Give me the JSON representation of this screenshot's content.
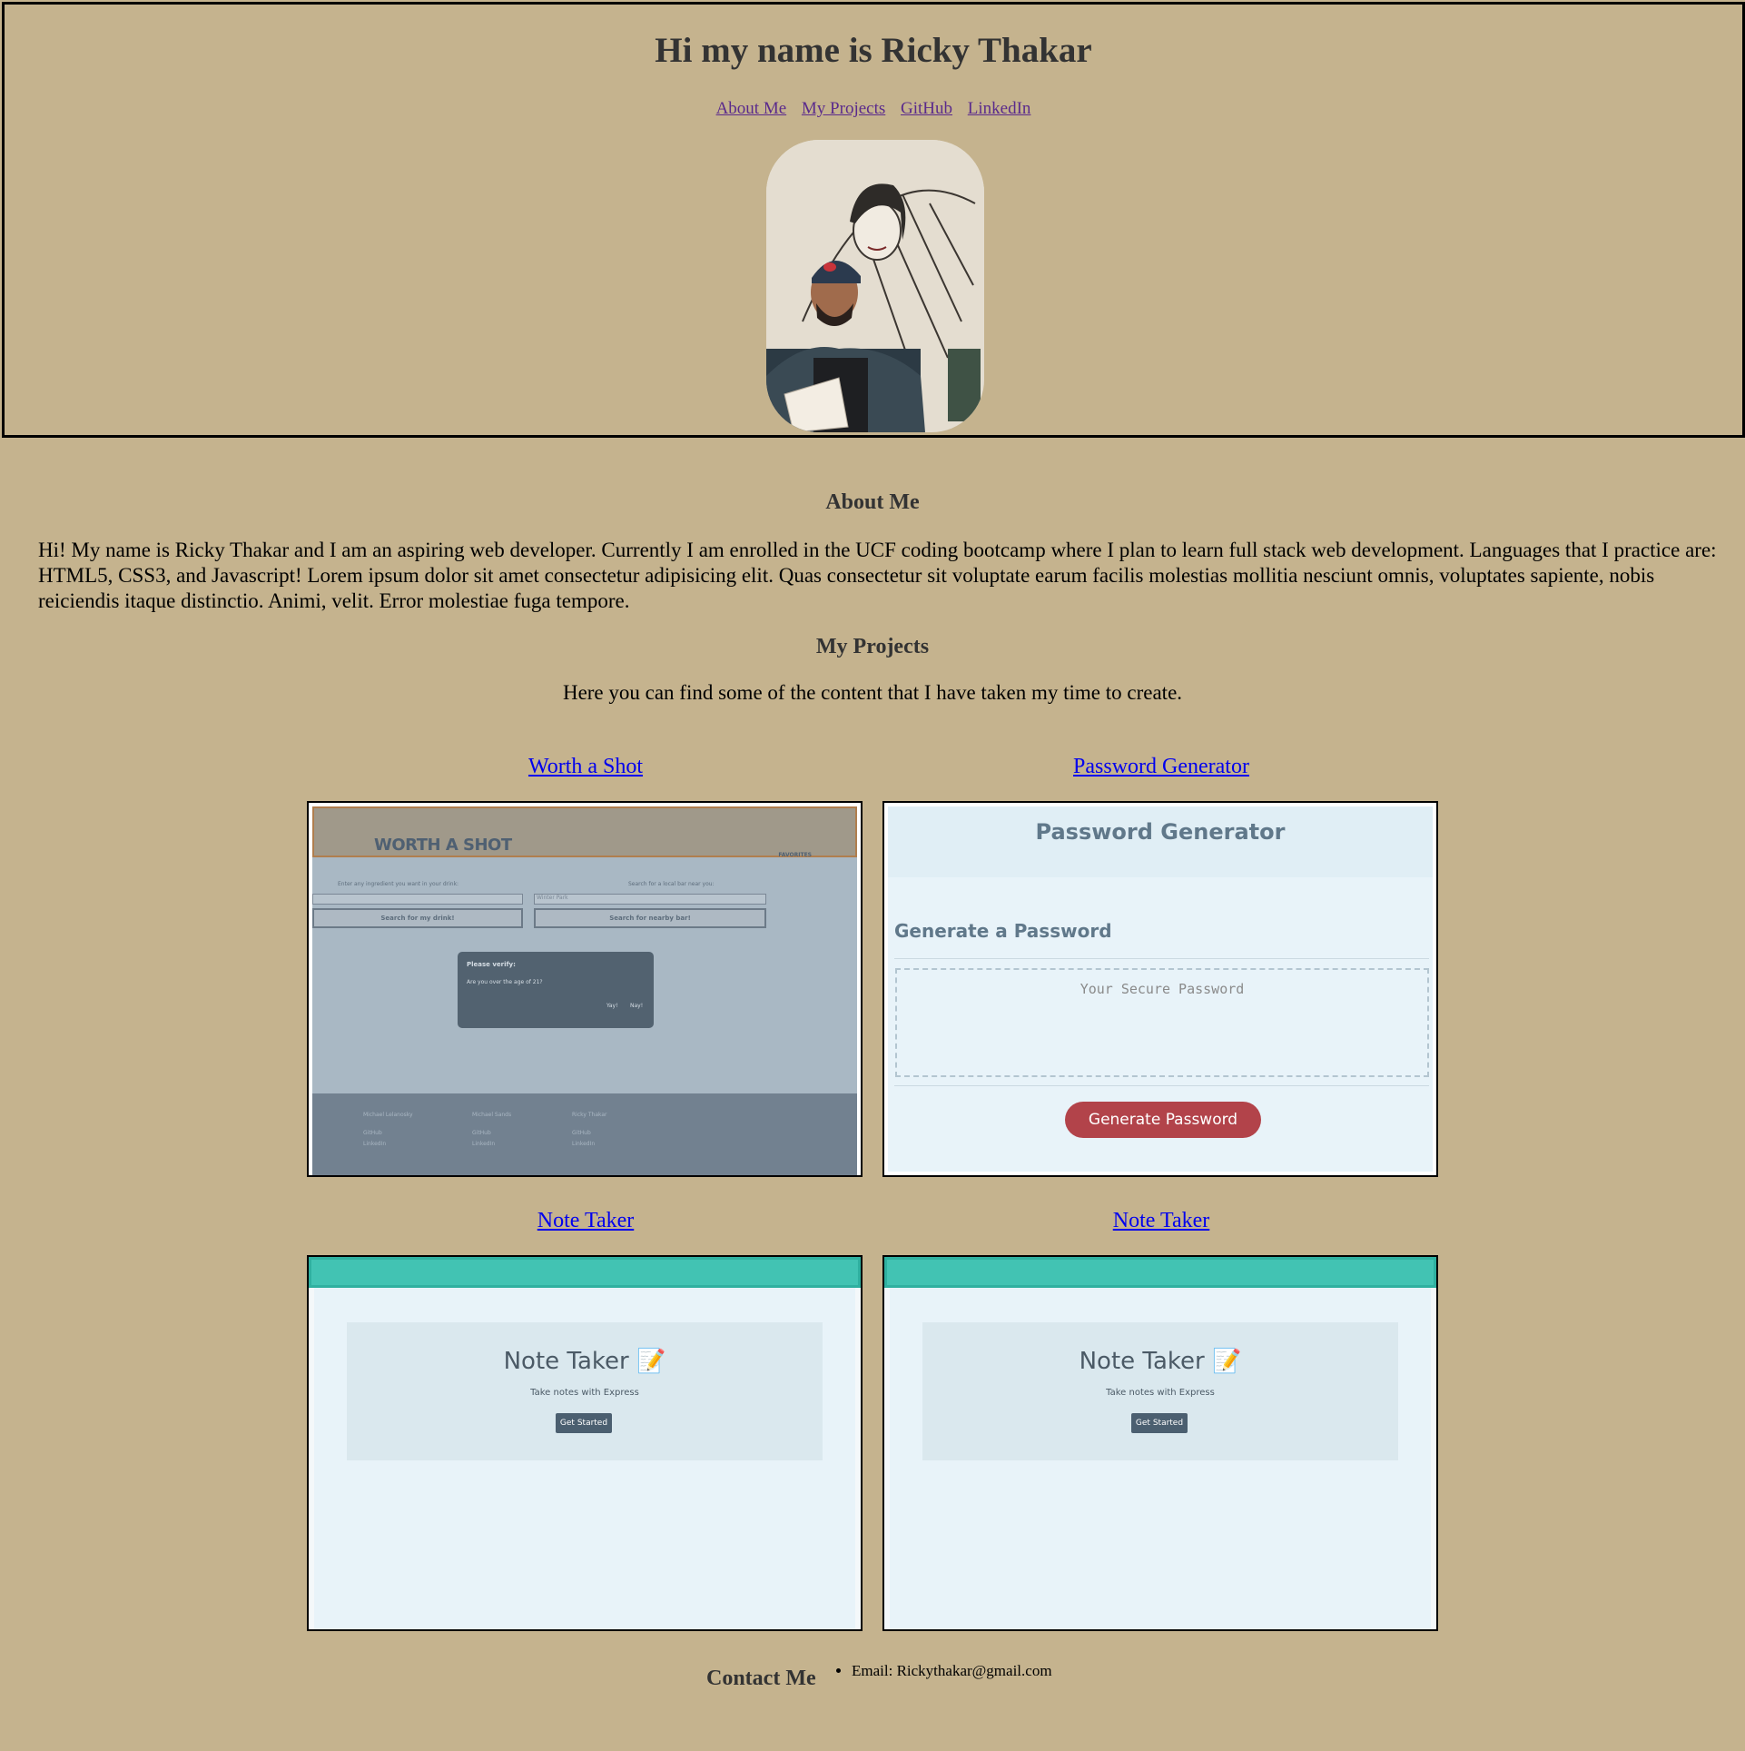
{
  "header": {
    "title": "Hi my name is Ricky Thakar",
    "nav": [
      "About Me",
      "My Projects",
      "GitHub",
      "LinkedIn"
    ]
  },
  "about": {
    "title": "About Me",
    "text": "Hi! My name is Ricky Thakar and I am an aspiring web developer. Currently I am enrolled in the UCF coding bootcamp where I plan to learn full stack web development. Languages that I practice are: HTML5, CSS3, and Javascript! Lorem ipsum dolor sit amet consectetur adipisicing elit. Quas consectetur sit voluptate earum facilis molestias mollitia nesciunt omnis, voluptates sapiente, nobis reiciendis itaque distinctio. Animi, velit. Error molestiae fuga tempore."
  },
  "projects": {
    "title": "My Projects",
    "intro": "Here you can find some of the content that I have taken my time to create.",
    "items": [
      {
        "title": "Worth a Shot"
      },
      {
        "title": "Password Generator"
      },
      {
        "title": "Note Taker"
      },
      {
        "title": "Note Taker"
      }
    ],
    "worth_a_shot": {
      "logo": "WORTH A SHOT",
      "favorites": "FAVORITES",
      "ingredient_label": "Enter any ingredient you want in your drink:",
      "bar_label": "Search for a local bar near you:",
      "bar_placeholder": "Winter Park",
      "drink_button": "Search for my drink!",
      "bar_button": "Search for nearby bar!",
      "modal_title": "Please verify:",
      "modal_text": "Are you over the age of 21?",
      "modal_yes": "Yay!",
      "modal_no": "Nay!",
      "team": [
        {
          "name": "Michael Lelanosky",
          "github": "GitHub",
          "linkedin": "LinkedIn"
        },
        {
          "name": "Michael Sands",
          "github": "GitHub",
          "linkedin": "LinkedIn"
        },
        {
          "name": "Ricky Thakar",
          "github": "GitHub",
          "linkedin": "LinkedIn"
        }
      ]
    },
    "password_generator": {
      "title": "Password Generator",
      "subtitle": "Generate a Password",
      "placeholder": "Your Secure Password",
      "button": "Generate Password"
    },
    "note_taker": {
      "title": "Note Taker 📝",
      "subtitle": "Take notes with Express",
      "button": "Get Started"
    }
  },
  "contact": {
    "title": "Contact Me",
    "email": "Email: Rickythakar@gmail.com"
  },
  "colors": {
    "page_bg": "#c5b38e",
    "link": "#0000ee",
    "visited_link": "#5a2a8c",
    "note_taker_bar": "#42c3b3",
    "generate_button": "#b2434a"
  }
}
